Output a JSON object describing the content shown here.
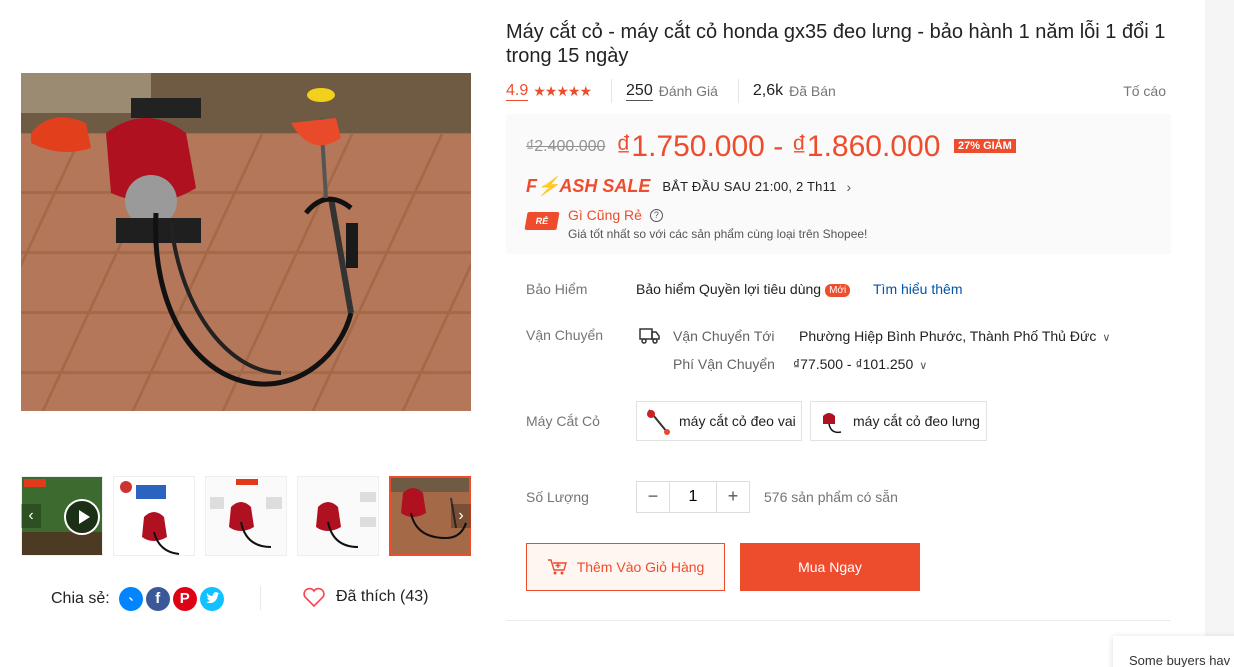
{
  "product": {
    "title": "Máy cắt cỏ - máy cắt cỏ honda gx35 đeo lưng - bảo hành 1 năm lỗi 1 đổi 1 trong 15 ngày",
    "rating": "4.9",
    "rating_stars": 5,
    "reviews_count": "250",
    "reviews_label": "Đánh Giá",
    "sold_count": "2,6k",
    "sold_label": "Đã Bán",
    "report_label": "Tố cáo"
  },
  "price": {
    "old": "₫2.400.000",
    "current": "₫1.750.000 - ₫1.860.000",
    "discount_badge": "27% GIẢM"
  },
  "flash_sale": {
    "logo": "F⚡ASH SALE",
    "time_text": "BẮT ĐẦU SAU 21:00, 2 Th11"
  },
  "cheap_guarantee": {
    "icon_text": "RẺ",
    "title": "Gì Cũng Rẻ",
    "subtitle": "Giá tốt nhất so với các sản phẩm cùng loại trên Shopee!"
  },
  "insurance": {
    "label": "Bảo Hiểm",
    "value": "Bảo hiểm Quyền lợi tiêu dùng",
    "badge": "Mới",
    "link": "Tìm hiểu thêm"
  },
  "shipping": {
    "label": "Vận Chuyển",
    "to_label": "Vận Chuyển Tới",
    "to_value": "Phường Hiệp Bình Phước, Thành Phố Thủ Đức",
    "fee_label": "Phí Vận Chuyển",
    "fee_value": "₫77.500 - ₫101.250"
  },
  "variants": {
    "label": "Máy Cắt Cỏ",
    "options": [
      "máy cắt cỏ đeo vai",
      "máy cắt cỏ đeo lưng"
    ]
  },
  "quantity": {
    "label": "Số Lượng",
    "value": "1",
    "minus": "−",
    "plus": "+",
    "stock_text": "576 sản phẩm có sẵn"
  },
  "actions": {
    "add_to_cart": "Thêm Vào Giỏ Hàng",
    "buy_now": "Mua Ngay"
  },
  "social": {
    "share_label": "Chia sẻ:",
    "liked_label": "Đã thích (43)"
  },
  "popup": {
    "text": "Some buyers hav"
  },
  "colors": {
    "accent": "#ee4d2d",
    "link": "#0055aa",
    "messenger": "#0084ff",
    "facebook": "#3b5999",
    "pinterest": "#de0217",
    "twitter": "#10c2ff"
  }
}
